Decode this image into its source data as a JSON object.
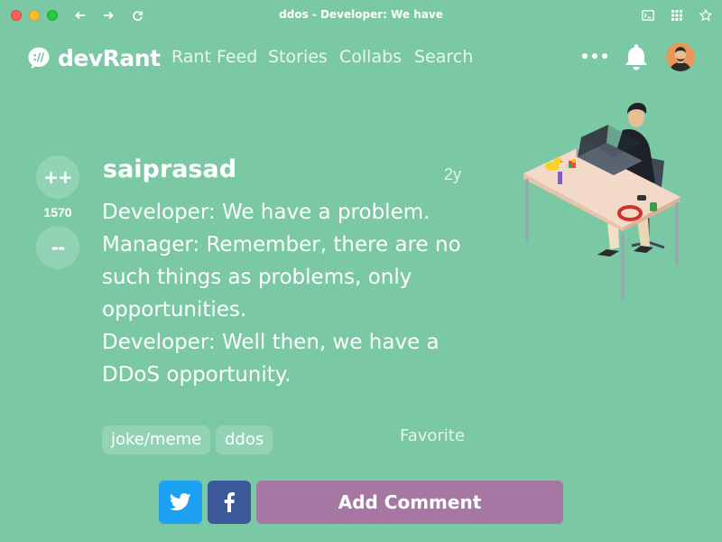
{
  "window": {
    "title": "ddos - Developer: We have"
  },
  "nav": {
    "logo_text": "devRant",
    "links": [
      "Rant Feed",
      "Stories",
      "Collabs",
      "Search"
    ]
  },
  "rant": {
    "username": "saiprasad",
    "age": "2y",
    "score": "1570",
    "upvote_label": "++",
    "downvote_label": "--",
    "text": "Developer: We have a problem.\nManager: Remember, there are no such things as problems, only opportunities.\nDeveloper: Well then, we have a DDoS opportunity.",
    "tags": [
      "joke/meme",
      "ddos"
    ],
    "favorite_label": "Favorite"
  },
  "actions": {
    "twitter_icon": "twitter-icon",
    "facebook_icon": "facebook-icon",
    "add_comment_label": "Add Comment"
  },
  "colors": {
    "background": "#7bc8a4",
    "vote_button": "#93d3b5",
    "twitter": "#1da1f2",
    "facebook": "#3b5998",
    "comment_button": "#a777a3"
  }
}
